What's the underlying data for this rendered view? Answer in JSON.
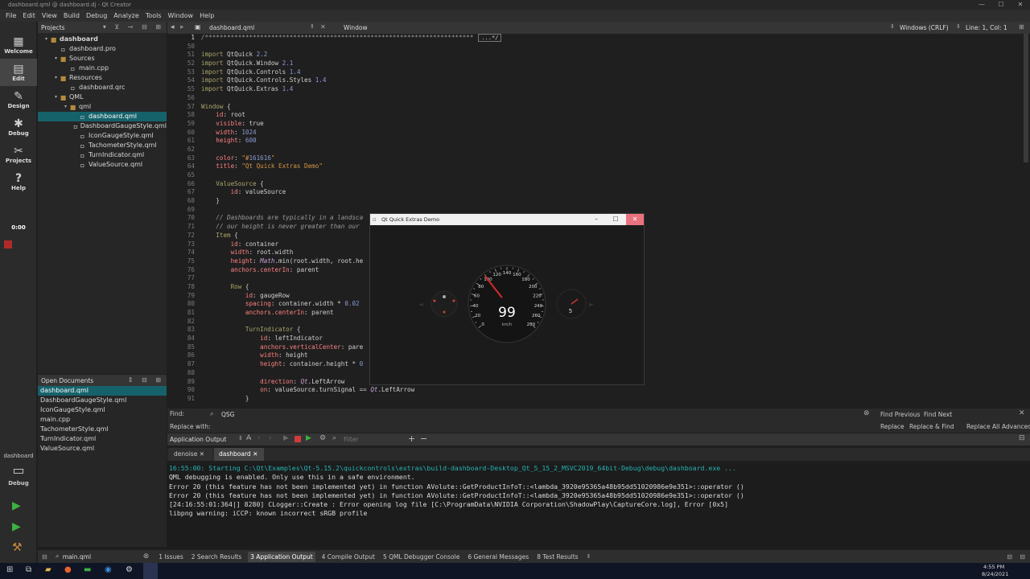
{
  "window": {
    "title": "dashboard.qml @ dashboard.dj - Qt Creator",
    "controls": [
      "—",
      "☐",
      "✕"
    ]
  },
  "menu": [
    "File",
    "Edit",
    "View",
    "Build",
    "Debug",
    "Analyze",
    "Tools",
    "Window",
    "Help"
  ],
  "modes": [
    {
      "label": "Welcome",
      "icon": "▦"
    },
    {
      "label": "Edit",
      "icon": "▤"
    },
    {
      "label": "Design",
      "icon": "✎"
    },
    {
      "label": "Debug",
      "icon": "✱"
    },
    {
      "label": "Projects",
      "icon": "✂"
    },
    {
      "label": "Help",
      "icon": "?"
    }
  ],
  "timer": "0:00",
  "kit": {
    "project": "dashboard",
    "mode": "Debug"
  },
  "projects": {
    "header": "Projects",
    "tree": [
      {
        "label": "dashboard",
        "depth": 0,
        "icon": "folder",
        "bold": true
      },
      {
        "label": "dashboard.pro",
        "depth": 1,
        "icon": "doc"
      },
      {
        "label": "Sources",
        "depth": 1,
        "icon": "folder"
      },
      {
        "label": "main.cpp",
        "depth": 2,
        "icon": "doc"
      },
      {
        "label": "Resources",
        "depth": 1,
        "icon": "folder"
      },
      {
        "label": "dashboard.qrc",
        "depth": 2,
        "icon": "doc"
      },
      {
        "label": "QML",
        "depth": 1,
        "icon": "folder"
      },
      {
        "label": "qml",
        "depth": 2,
        "icon": "folder"
      },
      {
        "label": "dashboard.qml",
        "depth": 3,
        "icon": "doc",
        "selected": true
      },
      {
        "label": "DashboardGaugeStyle.qml",
        "depth": 3,
        "icon": "doc"
      },
      {
        "label": "IconGaugeStyle.qml",
        "depth": 3,
        "icon": "doc"
      },
      {
        "label": "TachometerStyle.qml",
        "depth": 3,
        "icon": "doc"
      },
      {
        "label": "TurnIndicator.qml",
        "depth": 3,
        "icon": "doc"
      },
      {
        "label": "ValueSource.qml",
        "depth": 3,
        "icon": "doc"
      }
    ]
  },
  "open_documents": {
    "header": "Open Documents",
    "items": [
      "dashboard.qml",
      "DashboardGaugeStyle.qml",
      "IconGaugeStyle.qml",
      "main.cpp",
      "TachometerStyle.qml",
      "TurnIndicator.qml",
      "ValueSource.qml"
    ]
  },
  "editor": {
    "file": "dashboard.qml",
    "symbol": "Window",
    "encoding": "Windows (CRLF)",
    "position": "Line: 1, Col: 1",
    "collapsed_marker": "...*/",
    "line_numbers": [
      "1",
      "50",
      "51",
      "52",
      "53",
      "54",
      "55",
      "56",
      "57",
      "58",
      "59",
      "60",
      "61",
      "62",
      "63",
      "64",
      "65",
      "66",
      "67",
      "68",
      "69",
      "70",
      "71",
      "72",
      "73",
      "74",
      "75",
      "76",
      "77",
      "78",
      "79",
      "80",
      "81",
      "82",
      "83",
      "84",
      "85",
      "86",
      "87",
      "88",
      "89",
      "90",
      "91"
    ],
    "lines": [
      "/*************************************************************************",
      "",
      "import QtQuick 2.2",
      "import QtQuick.Window 2.1",
      "import QtQuick.Controls 1.4",
      "import QtQuick.Controls.Styles 1.4",
      "import QtQuick.Extras 1.4",
      "",
      "Window {",
      "    id: root",
      "    visible: true",
      "    width: 1024",
      "    height: 600",
      "",
      "    color: \"#161616\"",
      "    title: \"Qt Quick Extras Demo\"",
      "",
      "    ValueSource {",
      "        id: valueSource",
      "    }",
      "",
      "    // Dashboards are typically in a landsca",
      "    // our height is never greater than our",
      "    Item {",
      "        id: container",
      "        width: root.width",
      "        height: Math.min(root.width, root.he",
      "        anchors.centerIn: parent",
      "",
      "        Row {",
      "            id: gaugeRow",
      "            spacing: container.width * 0.02",
      "            anchors.centerIn: parent",
      "",
      "            TurnIndicator {",
      "                id: leftIndicator",
      "                anchors.verticalCenter: pare",
      "                width: height",
      "                height: container.height * 0",
      "",
      "                direction: Qt.LeftArrow",
      "                on: valueSource.turnSignal == Qt.LeftArrow",
      "            }"
    ]
  },
  "find": {
    "find_label": "Find:",
    "find_value": "QSG",
    "replace_label": "Replace with:",
    "find_previous": "Find Previous",
    "find_next": "Find Next",
    "replace": "Replace",
    "replace_find": "Replace & Find",
    "replace_all": "Replace All",
    "advanced": "Advanced..."
  },
  "output": {
    "header": "Application Output",
    "filter_placeholder": "Filter",
    "tabs": [
      "denoise",
      "dashboard"
    ],
    "lines": [
      "16:55:00: Starting C:\\Qt\\Examples\\Qt-5.15.2\\quickcontrols\\extras\\build-dashboard-Desktop_Qt_5_15_2_MSVC2019_64bit-Debug\\debug\\dashboard.exe ...",
      "QML debugging is enabled. Only use this in a safe environment.",
      "Error 20 (this feature has not been implemented yet) in function AVolute::GetProductInfoT::<lambda_3920e95365a48b95dd51020986e9e351>::operator ()",
      "Error 20 (this feature has not been implemented yet) in function AVolute::GetProductInfoT::<lambda_3920e95365a48b95dd51020986e9e351>::operator ()",
      "[24:16:55:01:364|] 8280] CLogger::Create : Error opening log file [C:\\ProgramData\\NVIDIA Corporation\\ShadowPlay\\CaptureCore.log], Error [0x5]",
      "libpng warning: iCCP: known incorrect sRGB profile"
    ]
  },
  "status": {
    "locator_value": "main.qml",
    "tabs": [
      "1  Issues",
      "2  Search Results",
      "3  Application Output",
      "4  Compile Output",
      "5  QML Debugger Console",
      "6  General Messages",
      "8  Test Results"
    ]
  },
  "taskbar": {
    "time": "4:55 PM",
    "date": "8/24/2021"
  },
  "app_window": {
    "title": "Qt Quick Extras Demo",
    "speed": "99",
    "unit": "km/h",
    "speed_ticks": [
      "0",
      "20",
      "40",
      "60",
      "80",
      "100",
      "120",
      "140",
      "160",
      "180",
      "200",
      "220",
      "240",
      "260",
      "280"
    ],
    "needle_value": 99,
    "gear": "5",
    "colors": {
      "needle": "#d42b2b",
      "background": "#161616"
    }
  }
}
